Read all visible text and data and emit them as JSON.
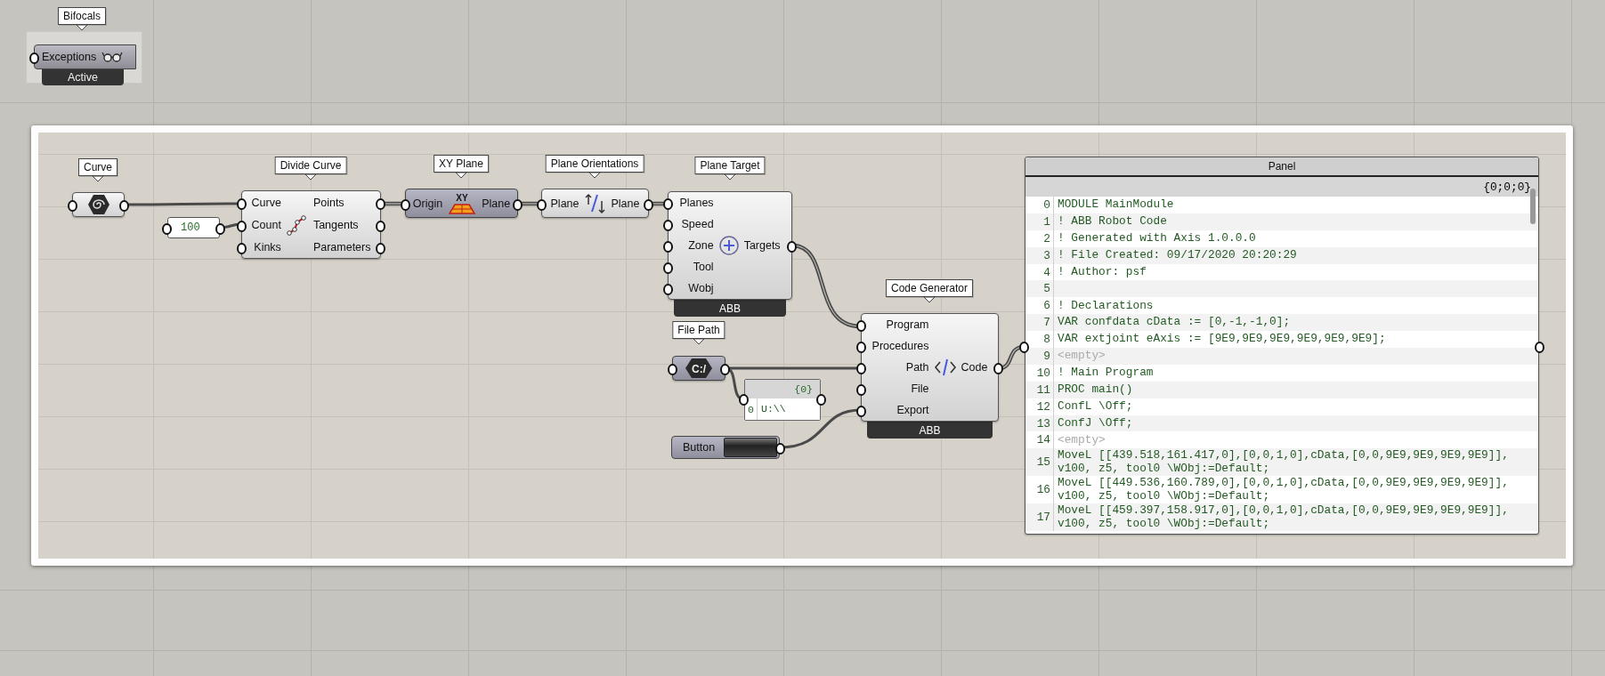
{
  "bifocals": {
    "tag": "Bifocals",
    "label": "Exceptions",
    "status": "Active"
  },
  "components": [
    {
      "kind": "param",
      "tag": "Curve",
      "shaded": false
    },
    {
      "kind": "number",
      "value": "100"
    },
    {
      "kind": "component",
      "tag": "Divide Curve",
      "inputs": [
        "Curve",
        "Count",
        "Kinks"
      ],
      "outputs": [
        "Points",
        "Tangents",
        "Parameters"
      ],
      "shaded": false
    },
    {
      "kind": "component",
      "tag": "XY Plane",
      "icon_text": "XY",
      "inputs": [
        "Origin"
      ],
      "outputs": [
        "Plane"
      ],
      "shaded": true
    },
    {
      "kind": "component",
      "tag": "Plane Orientations",
      "inputs": [
        "Plane"
      ],
      "outputs": [
        "Plane"
      ],
      "shaded": false
    },
    {
      "kind": "component",
      "tag": "Plane Target",
      "inputs": [
        "Planes",
        "Speed",
        "Zone",
        "Tool",
        "Wobj"
      ],
      "outputs": [
        "Targets"
      ],
      "footer": "ABB",
      "shaded": false
    },
    {
      "kind": "component",
      "tag": "Code Generator",
      "inputs": [
        "Program",
        "Procedures",
        "Path",
        "File",
        "Export"
      ],
      "outputs": [
        "Code"
      ],
      "footer": "ABB",
      "shaded": false
    },
    {
      "kind": "param",
      "tag": "File Path",
      "icon_text": "C:/",
      "shaded": true
    },
    {
      "kind": "panel",
      "path": "{0}",
      "rows": [
        {
          "index": "0",
          "text": "U:\\\\",
          "kind": "text"
        }
      ]
    },
    {
      "kind": "button",
      "label": "Button",
      "shaded": true
    },
    {
      "kind": "panel",
      "title": "Panel",
      "path": "{0;0;0}",
      "rows": [
        {
          "index": "0",
          "text": "MODULE MainModule",
          "kind": "text"
        },
        {
          "index": "1",
          "text": "! ABB Robot Code",
          "kind": "text"
        },
        {
          "index": "2",
          "text": "! Generated with Axis 1.0.0.0",
          "kind": "text"
        },
        {
          "index": "3",
          "text": "! File Created: 09/17/2020 20:20:29",
          "kind": "text"
        },
        {
          "index": "4",
          "text": "! Author: psf",
          "kind": "text"
        },
        {
          "index": "5"
        },
        {
          "index": "6",
          "text": "! Declarations",
          "kind": "text"
        },
        {
          "index": "7",
          "text": "VAR confdata cData := [0,-1,-1,0];",
          "kind": "text"
        },
        {
          "index": "8",
          "text": "VAR extjoint eAxis := [9E9,9E9,9E9,9E9,9E9,9E9];",
          "kind": "text"
        },
        {
          "index": "9",
          "text": "<empty>",
          "kind": "empty"
        },
        {
          "index": "10",
          "text": "! Main Program",
          "kind": "text"
        },
        {
          "index": "11",
          "text": "PROC main()",
          "kind": "text"
        },
        {
          "index": "12",
          "text": "ConfL \\Off;",
          "kind": "text"
        },
        {
          "index": "13",
          "text": "ConfJ \\Off;",
          "kind": "text"
        },
        {
          "index": "14",
          "text": "<empty>",
          "kind": "empty"
        },
        {
          "index": "15",
          "text": "MoveL [[439.518,161.417,0],[0,0,1,0],cData,[0,0,9E9,9E9,9E9,9E9]], v100, z5, tool0 \\WObj:=Default;",
          "kind": "text"
        },
        {
          "index": "16",
          "text": "MoveL [[449.536,160.789,0],[0,0,1,0],cData,[0,0,9E9,9E9,9E9,9E9]], v100, z5, tool0 \\WObj:=Default;",
          "kind": "text"
        },
        {
          "index": "17",
          "text": "MoveL [[459.397,158.917,0],[0,0,1,0],cData,[0,0,9E9,9E9,9E9,9E9]], v100, z5, tool0 \\WObj:=Default;",
          "kind": "text"
        }
      ]
    }
  ]
}
